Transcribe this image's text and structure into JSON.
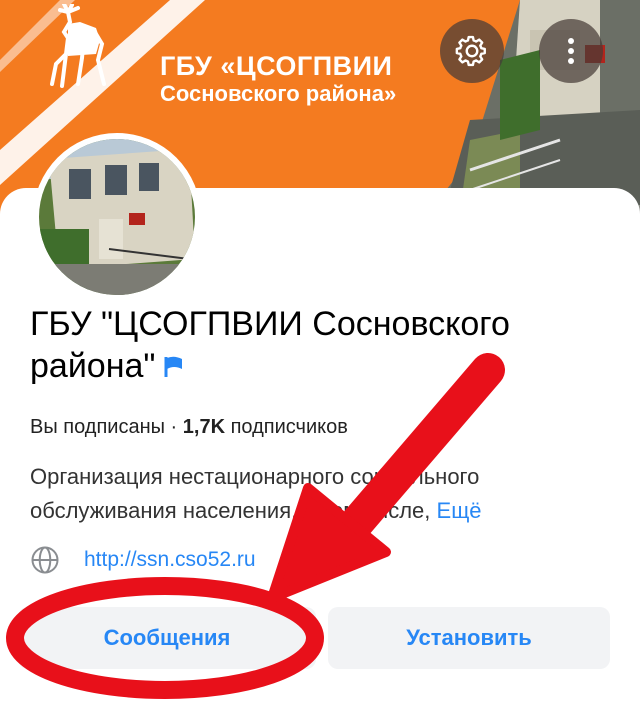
{
  "cover": {
    "title_line1": "ГБУ «ЦСОГПВИИ",
    "title_line2": "Сосновского района»",
    "brand_color": "#f47b20"
  },
  "header_actions": {
    "settings_icon": "gear-icon",
    "more_icon": "more-vertical-icon"
  },
  "community": {
    "name": "ГБУ \"ЦСОГПВИИ Сосновского района\"",
    "verified_icon": "flag-icon",
    "subscription_status": "Вы подписаны",
    "separator": " · ",
    "subscribers_count": "1,7K",
    "subscribers_label": "подписчиков",
    "description": "Организация нестационарного социального обслуживания населения, в том числе,",
    "description_more": "Ещё",
    "link_icon": "globe-icon",
    "link": "http://ssn.cso52.ru"
  },
  "buttons": {
    "messages": "Сообщения",
    "install": "Установить"
  },
  "colors": {
    "accent": "#2787f5",
    "annotation": "#e8101a",
    "button_bg": "#f2f3f5"
  }
}
